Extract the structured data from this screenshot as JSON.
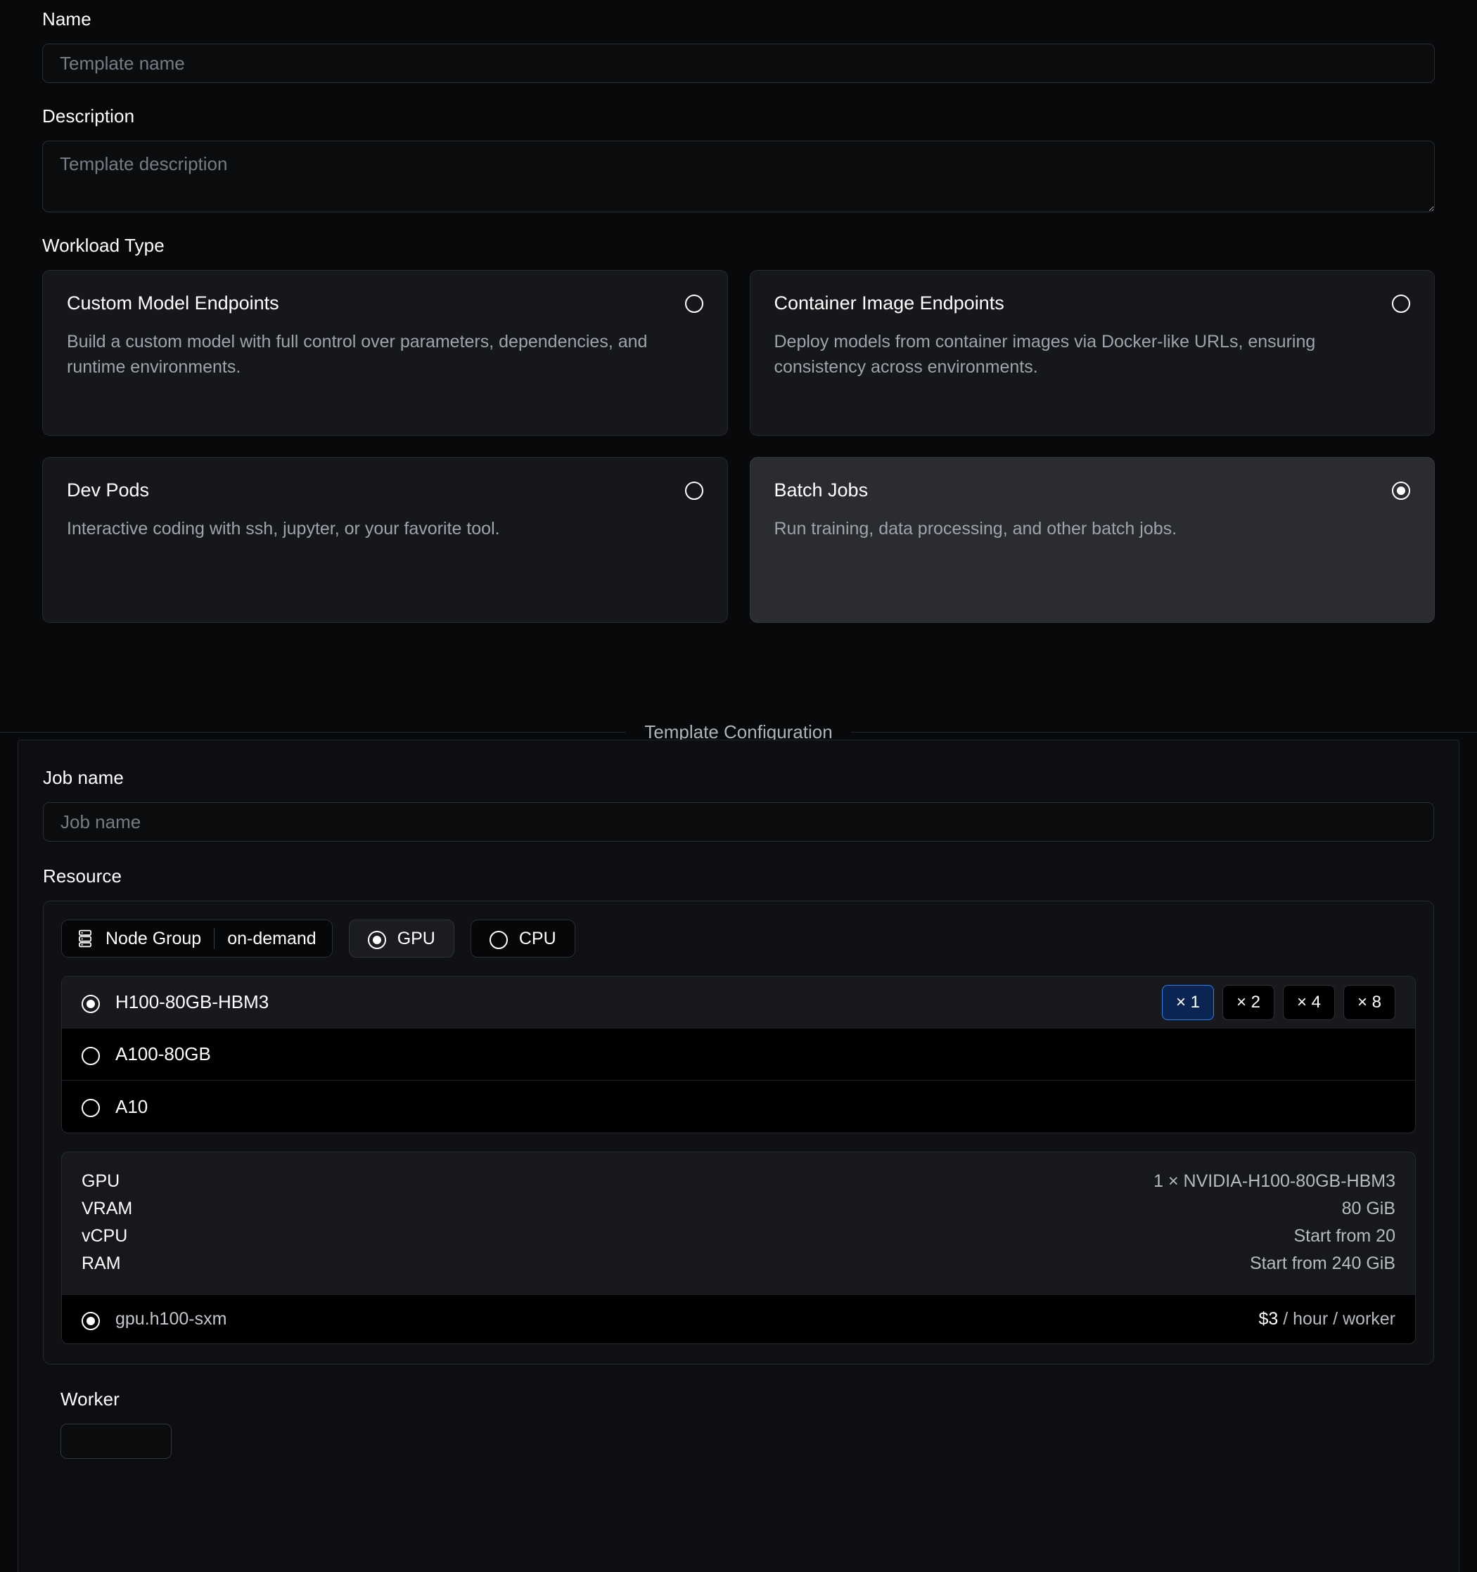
{
  "form": {
    "name": {
      "label": "Name",
      "placeholder": "Template name",
      "value": ""
    },
    "description": {
      "label": "Description",
      "placeholder": "Template description",
      "value": ""
    }
  },
  "workload": {
    "label": "Workload Type",
    "options": [
      {
        "title": "Custom Model Endpoints",
        "description": "Build a custom model with full control over parameters, dependencies, and runtime environments.",
        "selected": false
      },
      {
        "title": "Container Image Endpoints",
        "description": "Deploy models from container images via Docker-like URLs, ensuring consistency across environments.",
        "selected": false
      },
      {
        "title": "Dev Pods",
        "description": "Interactive coding with ssh, jupyter, or your favorite tool.",
        "selected": false
      },
      {
        "title": "Batch Jobs",
        "description": "Run training, data processing, and other batch jobs.",
        "selected": true
      }
    ]
  },
  "divider": {
    "caption": "Template Configuration"
  },
  "config": {
    "job_name": {
      "label": "Job name",
      "placeholder": "Job name",
      "value": ""
    },
    "resource": {
      "label": "Resource",
      "node_group": {
        "icon": "server-icon",
        "label": "Node Group",
        "value": "on-demand"
      },
      "compute_toggle": [
        {
          "label": "GPU",
          "selected": true
        },
        {
          "label": "CPU",
          "selected": false
        }
      ],
      "gpu_options": [
        {
          "name": "H100-80GB-HBM3",
          "selected": true
        },
        {
          "name": "A100-80GB",
          "selected": false
        },
        {
          "name": "A10",
          "selected": false
        }
      ],
      "quantities": [
        {
          "label": "× 1",
          "value": 1,
          "active": true
        },
        {
          "label": "× 2",
          "value": 2,
          "active": false
        },
        {
          "label": "× 4",
          "value": 4,
          "active": false
        },
        {
          "label": "× 8",
          "value": 8,
          "active": false
        }
      ],
      "specs": [
        {
          "key": "GPU",
          "value": "1 × NVIDIA-H100-80GB-HBM3"
        },
        {
          "key": "VRAM",
          "value": "80 GiB"
        },
        {
          "key": "vCPU",
          "value": "Start from 20"
        },
        {
          "key": "RAM",
          "value": "Start from 240 GiB"
        }
      ],
      "flavor": {
        "name": "gpu.h100-sxm",
        "selected": true,
        "price_amount": "$3",
        "price_unit": "/ hour / worker"
      }
    },
    "worker": {
      "label": "Worker",
      "value": "",
      "placeholder": ""
    }
  },
  "colors": {
    "background": "#08090b",
    "panel": "#0d0e11",
    "card": "#15171a",
    "card_selected": "#2a2c30",
    "border": "#26292e",
    "accent_blue": "#2f7ef0",
    "accent_blue_fill": "#0b2553",
    "text_primary": "#ffffff",
    "text_muted": "#9ea4ad"
  }
}
